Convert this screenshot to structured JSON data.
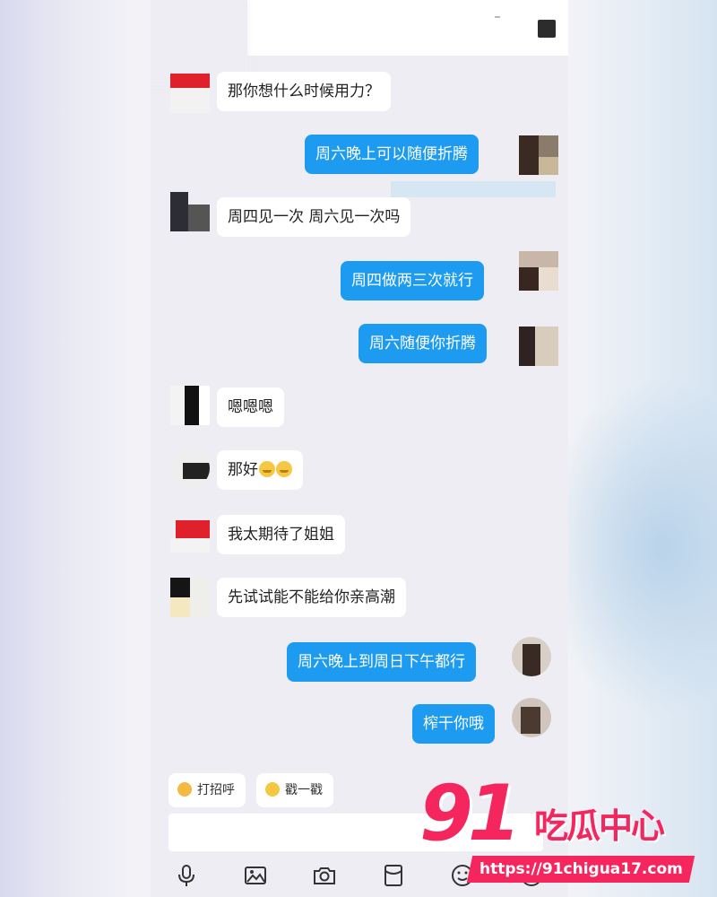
{
  "header": {
    "menu_icon": "more-icon"
  },
  "messages": [
    {
      "side": "in",
      "text": "那你想什么时候用力？"
    },
    {
      "side": "out",
      "text": "周六晚上可以随便折腾"
    },
    {
      "side": "in",
      "text": "周四见一次  周六见一次吗"
    },
    {
      "side": "out",
      "text": "周四做两三次就行"
    },
    {
      "side": "out",
      "text": "周六随便你折腾"
    },
    {
      "side": "in",
      "text": "嗯嗯嗯"
    },
    {
      "side": "in",
      "text": "那好",
      "emojis": [
        "grin-emoji",
        "grin-emoji"
      ]
    },
    {
      "side": "in",
      "text": "我太期待了姐姐"
    },
    {
      "side": "in",
      "text": "先试试能不能给你亲高潮"
    },
    {
      "side": "out",
      "text": "周六晚上到周日下午都行"
    },
    {
      "side": "out",
      "text": "榨干你哦"
    }
  ],
  "quick_replies": [
    {
      "icon": "wave-icon",
      "label": "打招呼"
    },
    {
      "icon": "poke-icon",
      "label": "戳一戳"
    }
  ],
  "input": {
    "placeholder": ""
  },
  "toolbar_icons": [
    "microphone-icon",
    "image-icon",
    "camera-icon",
    "red-packet-icon",
    "emoji-icon"
  ],
  "watermark": {
    "number": "91",
    "name": "吃瓜中心",
    "url": "https://91chigua17.com"
  },
  "colors": {
    "outgoing_bubble": "#1d9bf0",
    "incoming_bubble": "#ffffff",
    "chat_background": "#ededf3",
    "watermark": "#f5265e"
  }
}
